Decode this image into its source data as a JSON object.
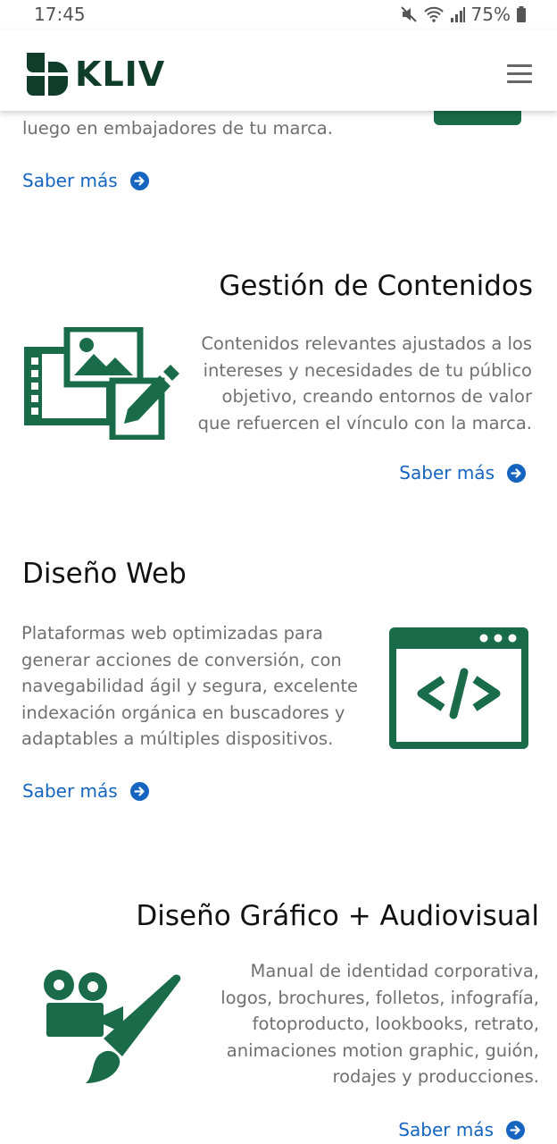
{
  "status_bar": {
    "time": "17:45",
    "battery": "75%",
    "icons": [
      "mute-icon",
      "wifi-icon",
      "signal-icon",
      "battery-icon"
    ]
  },
  "header": {
    "brand": "KLIV",
    "menu_icon": "hamburger-menu-icon"
  },
  "colors": {
    "brand_green": "#1a6b4a",
    "dark_green": "#0f3d2a",
    "link_blue": "#1565c0",
    "body_text": "#707070"
  },
  "sections": [
    {
      "description_tail": "luego en embajadores de tu marca.",
      "link_label": "Saber más"
    },
    {
      "title": "Gestión de Contenidos",
      "description_lines": [
        "Contenidos relevantes ajustados a los",
        "intereses y necesidades de tu público",
        "objetivo, creando entornos de valor",
        "que refuercen el vínculo con la marca."
      ],
      "icon": "content-management-icon",
      "link_label": "Saber más"
    },
    {
      "title": "Diseño Web",
      "description_lines": [
        "Plataformas web optimizadas para",
        "generar acciones de conversión, con",
        "navegabilidad ágil y segura, excelente",
        "indexación orgánica en buscadores y",
        "adaptables a múltiples dispositivos."
      ],
      "icon": "web-code-icon",
      "link_label": "Saber más"
    },
    {
      "title": "Diseño Gráfico + Audiovisual",
      "description_lines": [
        "Manual de identidad corporativa,",
        "logos, brochures, folletos, infografía,",
        "fotoproducto, lookbooks, retrato,",
        "animaciones motion graphic, guión,",
        "rodajes y producciones."
      ],
      "icon": "camera-brush-icon",
      "link_label": "Saber más"
    }
  ]
}
